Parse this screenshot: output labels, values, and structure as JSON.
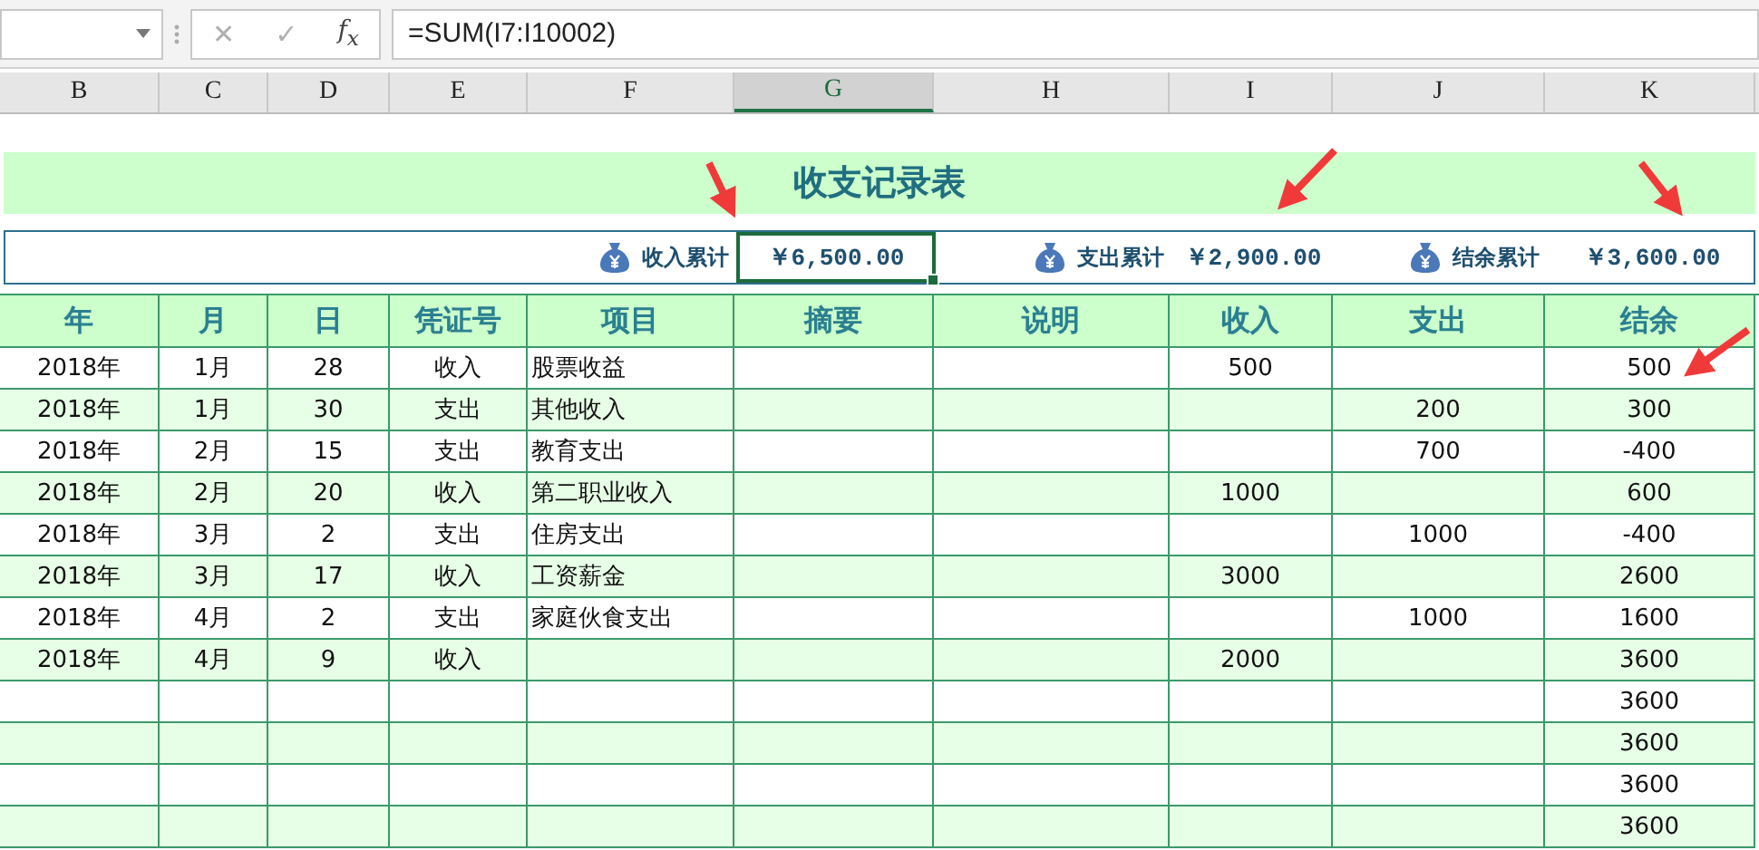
{
  "formula_bar": {
    "cancel": "✕",
    "enter": "✓",
    "function": "f$_{x}$",
    "formula": "=SUM(I7:I10002)"
  },
  "column_headers": [
    {
      "label": "B",
      "selected": false
    },
    {
      "label": "C",
      "selected": false
    },
    {
      "label": "D",
      "selected": false
    },
    {
      "label": "E",
      "selected": false
    },
    {
      "label": "F",
      "selected": false
    },
    {
      "label": "G",
      "selected": true
    },
    {
      "label": "H",
      "selected": false
    },
    {
      "label": "I",
      "selected": false
    },
    {
      "label": "J",
      "selected": false
    },
    {
      "label": "K",
      "selected": false
    }
  ],
  "title": "收支记录表",
  "summary": [
    {
      "label": "收入累计",
      "value": "￥6,500.00",
      "selected": true
    },
    {
      "label": "支出累计",
      "value": "￥2,900.00",
      "selected": false
    },
    {
      "label": "结余累计",
      "value": "￥3,600.00",
      "selected": false
    }
  ],
  "table": {
    "columns": [
      "年",
      "月",
      "日",
      "凭证号",
      "项目",
      "摘要",
      "说明",
      "收入",
      "支出",
      "结余"
    ],
    "rows": [
      {
        "year": "2018年",
        "month": "1月",
        "day": "28",
        "voucher": "收入",
        "item": "股票收益",
        "income": "500",
        "balance": "500"
      },
      {
        "year": "2018年",
        "month": "1月",
        "day": "30",
        "voucher": "支出",
        "item": "其他收入",
        "expense": "200",
        "balance": "300"
      },
      {
        "year": "2018年",
        "month": "2月",
        "day": "15",
        "voucher": "支出",
        "item": "教育支出",
        "expense": "700",
        "balance": "-400"
      },
      {
        "year": "2018年",
        "month": "2月",
        "day": "20",
        "voucher": "收入",
        "item": "第二职业收入",
        "income": "1000",
        "balance": "600"
      },
      {
        "year": "2018年",
        "month": "3月",
        "day": "2",
        "voucher": "支出",
        "item": "住房支出",
        "expense": "1000",
        "balance": "-400"
      },
      {
        "year": "2018年",
        "month": "3月",
        "day": "17",
        "voucher": "收入",
        "item": "工资薪金",
        "income": "3000",
        "balance": "2600"
      },
      {
        "year": "2018年",
        "month": "4月",
        "day": "2",
        "voucher": "支出",
        "item": "家庭伙食支出",
        "expense": "1000",
        "balance": "1600"
      },
      {
        "year": "2018年",
        "month": "4月",
        "day": "9",
        "voucher": "收入",
        "income": "2000",
        "balance": "3600"
      },
      {
        "balance": "3600"
      },
      {
        "balance": "3600"
      },
      {
        "balance": "3600"
      },
      {
        "balance": "3600"
      }
    ]
  }
}
